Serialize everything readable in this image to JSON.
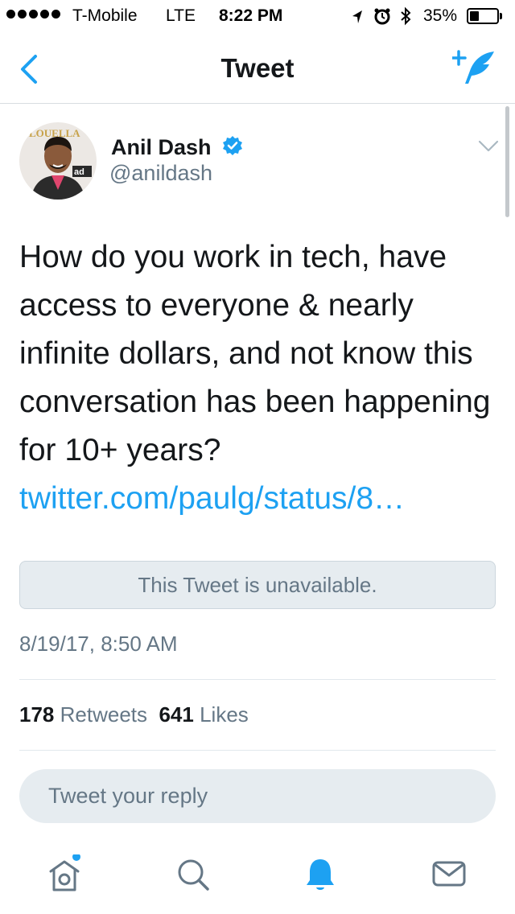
{
  "status_bar": {
    "carrier": "T-Mobile",
    "network": "LTE",
    "time": "8:22 PM",
    "battery_percent": "35%",
    "battery_level": 0.35,
    "icons": [
      "location-arrow-icon",
      "alarm-icon",
      "bluetooth-icon"
    ]
  },
  "nav": {
    "title": "Tweet",
    "back_icon": "chevron-left-icon",
    "compose_icon": "compose-tweet-icon",
    "accent_color": "#1da1f2"
  },
  "tweet": {
    "author_name": "Anil Dash",
    "verified": true,
    "handle": "@anildash",
    "text": "How do you work in tech, have access to everyone & nearly infinite dollars, and not know this conversation has been happening for 10+ years?",
    "link": "twitter.com/paulg/status/8…",
    "quoted_unavailable": "This Tweet is unavailable.",
    "timestamp": "8/19/17, 8:50 AM",
    "retweets_count": "178",
    "retweets_label": "Retweets",
    "likes_count": "641",
    "likes_label": "Likes"
  },
  "reply": {
    "placeholder": "Tweet your reply"
  },
  "tab_bar": {
    "items": [
      {
        "name": "home",
        "icon": "home-icon",
        "has_notification_dot": true
      },
      {
        "name": "search",
        "icon": "search-icon"
      },
      {
        "name": "notifications",
        "icon": "bell-icon",
        "active": true
      },
      {
        "name": "messages",
        "icon": "mail-icon"
      }
    ]
  }
}
